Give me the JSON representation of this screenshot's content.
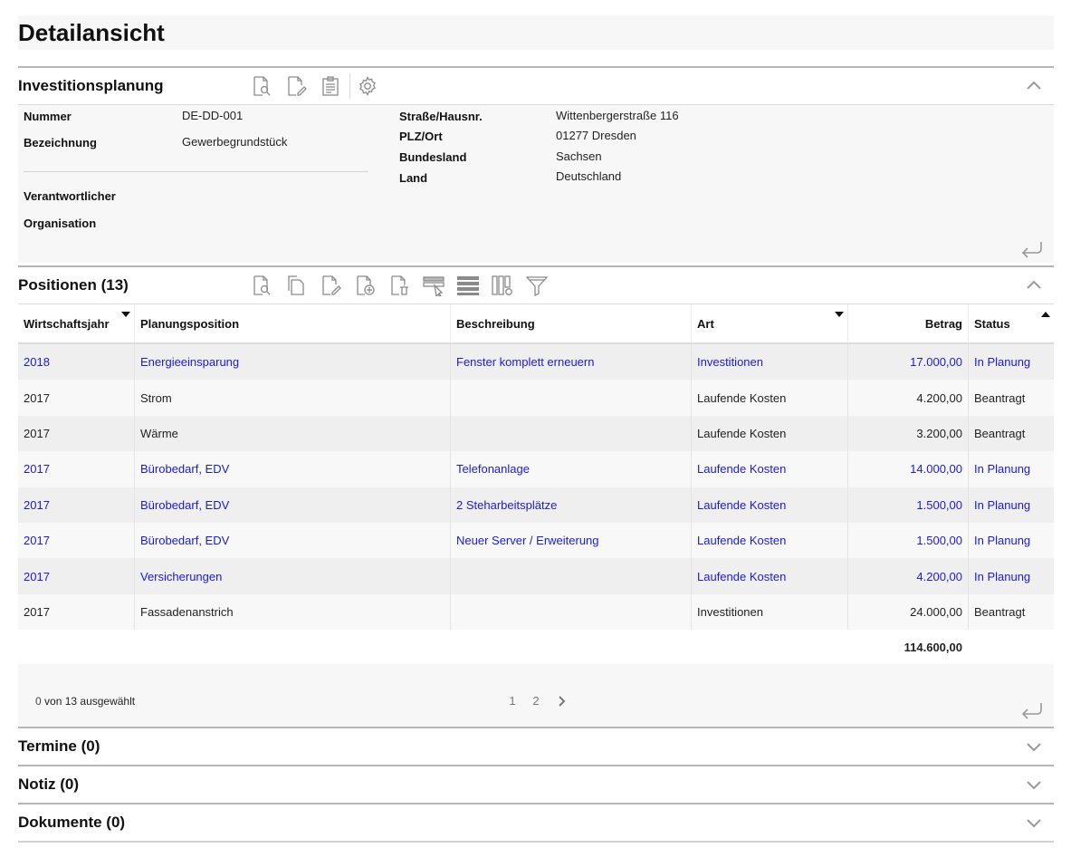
{
  "page": {
    "title": "Detailansicht"
  },
  "colors": {
    "link": "#1a1ae0",
    "panel_bg": "#f7f7f7",
    "border": "#b5b5b5"
  },
  "plan": {
    "title": "Investitionsplanung",
    "toolbar_icons": [
      "document-search-icon",
      "document-edit-icon",
      "clipboard-icon",
      "gear-icon"
    ],
    "fields_left": [
      {
        "label": "Nummer",
        "value": "DE-DD-001"
      },
      {
        "label": "Bezeichnung",
        "value": "Gewerbegrundstück"
      },
      {
        "label": "Verantwortlicher",
        "value": ""
      },
      {
        "label": "Organisation",
        "value": ""
      }
    ],
    "fields_right": [
      {
        "label": "Straße/Hausnr.",
        "value": "Wittenbergerstraße 116"
      },
      {
        "label": "PLZ/Ort",
        "value": "01277 Dresden"
      },
      {
        "label": "Bundesland",
        "value": "Sachsen"
      },
      {
        "label": "Land",
        "value": "Deutschland"
      }
    ]
  },
  "positions": {
    "title": "Positionen (13)",
    "toolbar_icons": [
      "document-search-icon",
      "copy-icon",
      "document-edit-icon",
      "document-add-icon",
      "document-delete-icon",
      "row-select-icon",
      "rows-icon",
      "column-settings-icon",
      "filter-icon"
    ],
    "columns": [
      "Wirtschaftsjahr",
      "Planungsposition",
      "Beschreibung",
      "Art",
      "Betrag",
      "Status"
    ],
    "rows": [
      {
        "jahr": "2018",
        "position": "Energieeinsparung",
        "beschreibung": "Fenster komplett erneuern",
        "art": "Investitionen",
        "betrag": "17.000,00",
        "status": "In Planung",
        "link": true
      },
      {
        "jahr": "2017",
        "position": "Strom",
        "beschreibung": "",
        "art": "Laufende Kosten",
        "betrag": "4.200,00",
        "status": "Beantragt",
        "link": false
      },
      {
        "jahr": "2017",
        "position": "Wärme",
        "beschreibung": "",
        "art": "Laufende Kosten",
        "betrag": "3.200,00",
        "status": "Beantragt",
        "link": false
      },
      {
        "jahr": "2017",
        "position": "Bürobedarf, EDV",
        "beschreibung": "Telefonanlage",
        "art": "Laufende Kosten",
        "betrag": "14.000,00",
        "status": "In Planung",
        "link": true
      },
      {
        "jahr": "2017",
        "position": "Bürobedarf, EDV",
        "beschreibung": "2 Steharbeitsplätze",
        "art": "Laufende Kosten",
        "betrag": "1.500,00",
        "status": "In Planung",
        "link": true
      },
      {
        "jahr": "2017",
        "position": "Bürobedarf, EDV",
        "beschreibung": "Neuer Server / Erweiterung",
        "art": "Laufende Kosten",
        "betrag": "1.500,00",
        "status": "In Planung",
        "link": true
      },
      {
        "jahr": "2017",
        "position": "Versicherungen",
        "beschreibung": "",
        "art": "Laufende Kosten",
        "betrag": "4.200,00",
        "status": "In Planung",
        "link": true
      },
      {
        "jahr": "2017",
        "position": "Fassadenanstrich",
        "beschreibung": "",
        "art": "Investitionen",
        "betrag": "24.000,00",
        "status": "Beantragt",
        "link": false
      }
    ],
    "total": "114.600,00",
    "selected_count": "0",
    "selected_text": "von 13 ausgewählt",
    "pages": [
      "1",
      "2"
    ]
  },
  "collapsed_sections": [
    {
      "title": "Termine (0)"
    },
    {
      "title": "Notiz (0)"
    },
    {
      "title": "Dokumente (0)"
    }
  ]
}
